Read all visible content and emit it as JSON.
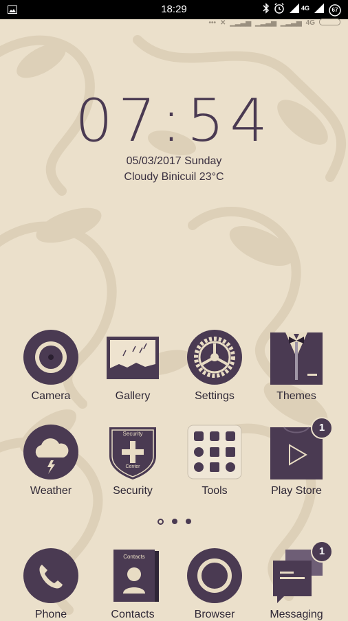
{
  "status_bar": {
    "time": "18:29",
    "network": "4G",
    "battery": "67",
    "sub_network": "4G"
  },
  "clock": {
    "time": "07:54",
    "date": "05/03/2017 Sunday",
    "weather": "Cloudy Binicuil 23°C"
  },
  "apps": [
    {
      "name": "Camera",
      "icon": "camera-icon"
    },
    {
      "name": "Gallery",
      "icon": "gallery-icon"
    },
    {
      "name": "Settings",
      "icon": "gear-icon"
    },
    {
      "name": "Themes",
      "icon": "tuxedo-icon"
    },
    {
      "name": "Weather",
      "icon": "cloud-lightning-icon"
    },
    {
      "name": "Security",
      "icon": "shield-plus-icon",
      "icon_text_top": "Security",
      "icon_text_bottom": "Center"
    },
    {
      "name": "Tools",
      "icon": "tools-folder-icon"
    },
    {
      "name": "Play Store",
      "icon": "play-icon",
      "badge": "1"
    }
  ],
  "page_indicator": {
    "count": 3,
    "active": 0
  },
  "dock": [
    {
      "name": "Phone",
      "icon": "phone-icon"
    },
    {
      "name": "Contacts",
      "icon": "contacts-icon",
      "icon_text": "Contacts"
    },
    {
      "name": "Browser",
      "icon": "browser-icon"
    },
    {
      "name": "Messaging",
      "icon": "message-icon",
      "badge": "1"
    }
  ],
  "colors": {
    "accent": "#4a3a52",
    "wallpaper": "#ebe0cb",
    "pattern": "#ddd0b8"
  }
}
